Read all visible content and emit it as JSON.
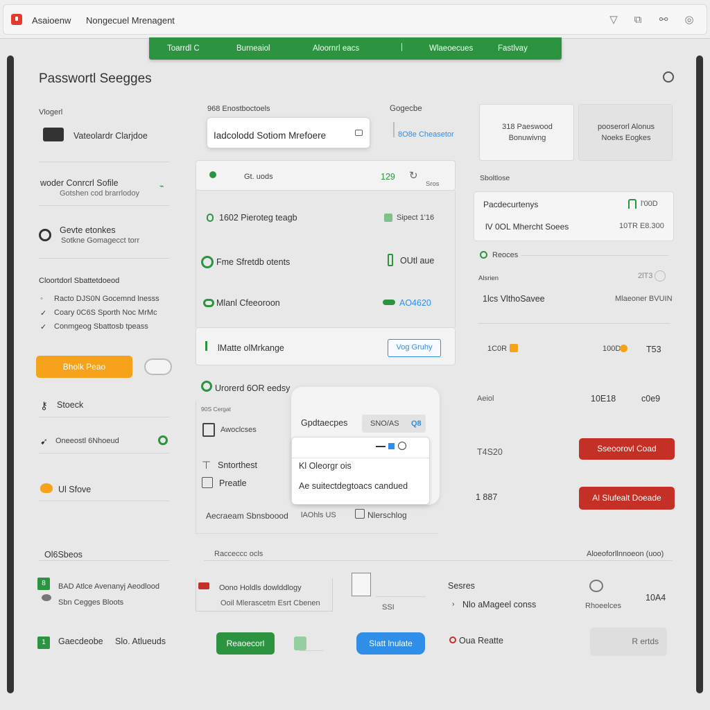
{
  "titlebar": {
    "app_name": "Asaioenw",
    "window_title": "Nongecuel Mrenagent"
  },
  "topnav": {
    "items": [
      "Toarrdl C",
      "Burneaiol",
      "Aloornrl eacs",
      "Wlaeoecues",
      "Fastlvay"
    ]
  },
  "page": {
    "title": "Passwortl Seegges"
  },
  "left": {
    "section_label": "Vlogerl",
    "vault_name": "Vateolardr Clarjdoe",
    "item1_title": "woder Conrcrl Sofile",
    "item1_sub": "Gotshen cod brarrlodoy",
    "item2_title": "Gevte etonkes",
    "item2_sub": "Sotkne Gomagecct torr",
    "section2": "Cloortdorl Sbattetdoeod",
    "lines": [
      "Racto DJS0N Gocemnd lnesss",
      "Coary 0C6S Sporth Noc MrMc",
      "Conmgeog Sbattosb tpeass"
    ],
    "orange_button": "Bholk Peao",
    "row_a": "Stoeck",
    "row_b": "Oneeostl 6Nhoeud",
    "row_c": "Ul Sfove",
    "section3": "Ol6Sbeos",
    "bottom_line1": "BAD Atlce Avenanyj Aeodlood",
    "bottom_line2": "Sbn Cegges Bloots",
    "bottom_item": "Gaecdeobe",
    "bottom_item_b": "Slo. Atlueuds"
  },
  "middle": {
    "header_label": "968 Enostboctoels",
    "search_value": "Iadcolodd Sotiom Mrefoere",
    "row1_label": "Gt. uods",
    "row1_value": "129",
    "row1_extra": "Sros",
    "list": [
      {
        "label": "1602 Pieroteg teagb",
        "value": "Sipect 1'16"
      },
      {
        "label": "Fme Sfretdb otents",
        "value": "OUtl aue"
      },
      {
        "label": "Mlanl Cfeeoroon",
        "value": "AO4620"
      }
    ],
    "footer_label": "lMatte olMrkange",
    "footer_button": "Vog Gruhy",
    "section_title": "Urorerd 6OR eedsy",
    "section_caption": "90S Cergat",
    "opt1": "Awoclcses",
    "opt2": "Sntorthest",
    "opt3": "Preatle",
    "popup_title": "Gpdtaecpes",
    "popup_badge": "SNO/AS",
    "popup_badge2": "Q8",
    "dropdown_line1": "Kl Oleorgr ois",
    "dropdown_line2": "Ae suitectdegtoacs candued",
    "footer_a": "Aecraeam Sbnsboood",
    "footer_b": "lAOhls US",
    "footer_c": "Nlerschlog",
    "bottom_label": "Racceccc ocls",
    "note_title": "Oono Holdls dowlddlogy",
    "note_sub": "Ooil Mlerascetm Esrt Cbenen",
    "note_num": "SSI",
    "green_button": "Reaoecorl",
    "blue_button": "Slatt lnulate"
  },
  "right": {
    "card1": "318 Paeswood Bonuwivng",
    "card2": "pooserorl Alonus Noeks Eogkes",
    "section_label": "Sboltlose",
    "row1_label": "Pacdecurtenys",
    "row1_value": "l'00D",
    "row2_label": "lV 0OL Mhercht Soees",
    "row2_value": "10TR E8.300",
    "radio_label": "Reoces",
    "sub_label": "Alsrien",
    "sub_value": "2lT3",
    "row3_label": "1lcs VlthoSavee",
    "row3_value": "Mlaeoner BVUIN",
    "stat_a": "1C0R",
    "stat_b": "100D",
    "stat_c": "T53",
    "row4_label": "Aeiol",
    "row4_value": "10E18",
    "row4_value2": "c0e9",
    "row5_label": "T4S20",
    "red_button1": "Sseoorovl Coad",
    "row6_label": "1 887",
    "red_button2": "Al Slufealt Doeade",
    "bottom_label": "Aloeoforllnnoeon (uoo)",
    "notes_title": "Sesres",
    "notes_sub": "Nlo aMageel conss",
    "notes_value": "10A4",
    "notes_caption": "Rhoeelces",
    "footer_link": "Oua Reatte",
    "grey_button": "R ertds"
  },
  "colors": {
    "green": "#2c9440",
    "orange": "#f6a21a",
    "red": "#c42f26",
    "blue": "#2f8ee8"
  }
}
